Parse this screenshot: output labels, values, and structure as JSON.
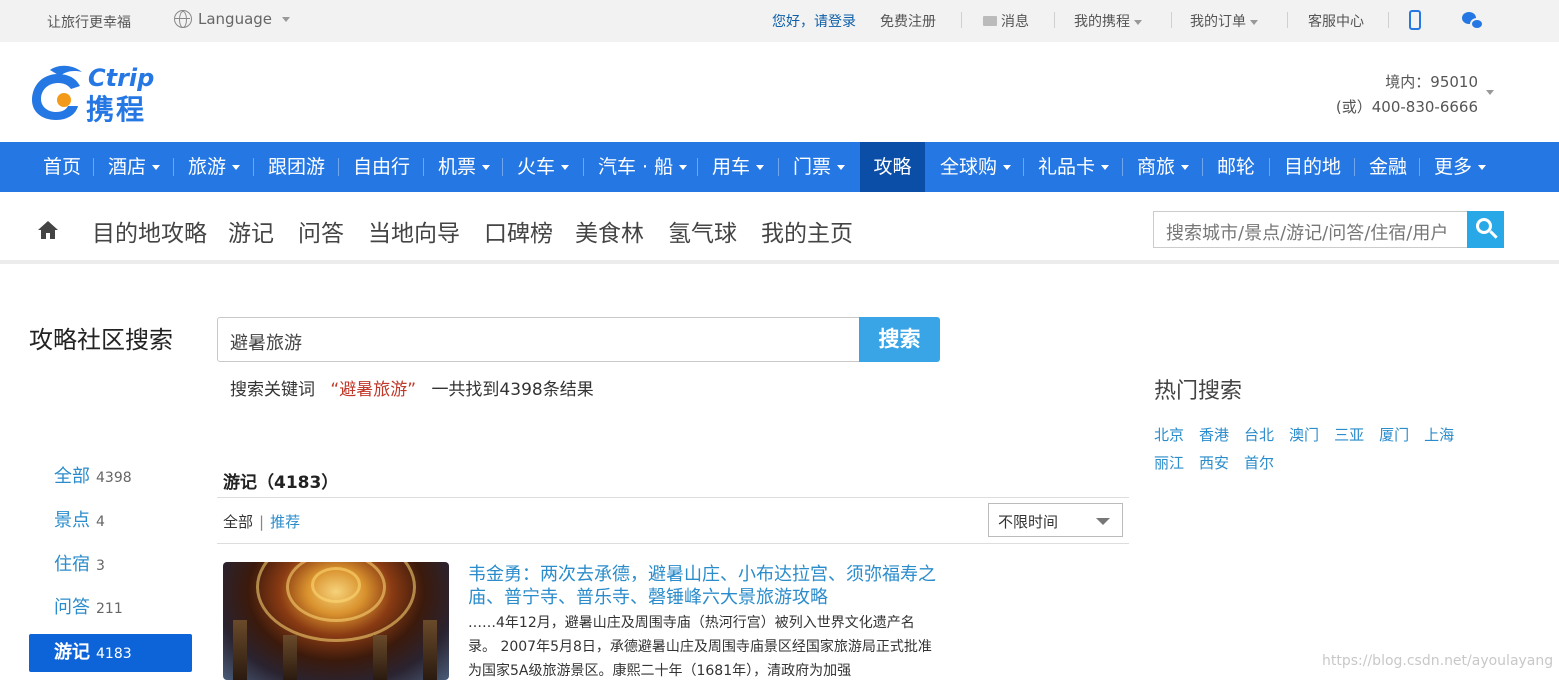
{
  "topbar": {
    "slogan": "让旅行更幸福",
    "language": "Language",
    "greeting": "您好，请登录",
    "register": "免费注册",
    "messages": "消息",
    "my_ctrip": "我的携程",
    "my_orders": "我的订单",
    "service": "客服中心"
  },
  "header": {
    "logo_en": "Ctrip",
    "logo_cn": "携程",
    "hotline_domestic": "境内：95010",
    "hotline_alt": "(或）400-830-6666"
  },
  "mainnav": [
    {
      "label": "首页",
      "caret": false
    },
    {
      "label": "酒店",
      "caret": true
    },
    {
      "label": "旅游",
      "caret": true
    },
    {
      "label": "跟团游",
      "caret": false
    },
    {
      "label": "自由行",
      "caret": false
    },
    {
      "label": "机票",
      "caret": true
    },
    {
      "label": "火车",
      "caret": true
    },
    {
      "label": "汽车 · 船",
      "caret": true
    },
    {
      "label": "用车",
      "caret": true
    },
    {
      "label": "门票",
      "caret": true
    },
    {
      "label": "攻略",
      "caret": false,
      "active": true
    },
    {
      "label": "全球购",
      "caret": true
    },
    {
      "label": "礼品卡",
      "caret": true
    },
    {
      "label": "商旅",
      "caret": true
    },
    {
      "label": "邮轮",
      "caret": false
    },
    {
      "label": "目的地",
      "caret": false
    },
    {
      "label": "金融",
      "caret": false
    },
    {
      "label": "更多",
      "caret": true
    }
  ],
  "subnav": {
    "links": [
      "目的地攻略",
      "游记",
      "问答",
      "当地向导",
      "口碑榜",
      "美食林",
      "氢气球",
      "我的主页"
    ],
    "search_placeholder": "搜索城市/景点/游记/问答/住宿/用户"
  },
  "search": {
    "page_title": "攻略社区搜索",
    "query": "避暑旅游",
    "button": "搜索",
    "result_prefix": "搜索关键词",
    "result_keyword": "“避暑旅游”",
    "result_suffix": "一共找到4398条结果"
  },
  "filters": [
    {
      "label": "全部",
      "count": "4398"
    },
    {
      "label": "景点",
      "count": "4"
    },
    {
      "label": "住宿",
      "count": "3"
    },
    {
      "label": "问答",
      "count": "211"
    },
    {
      "label": "游记",
      "count": "4183",
      "active": true
    }
  ],
  "results": {
    "section_title": "游记（4183）",
    "tab_all": "全部",
    "tab_sep": "|",
    "tab_recommended": "推荐",
    "time_filter": "不限时间",
    "items": [
      {
        "title": "韦金勇：两次去承德，避暑山庄、小布达拉宫、须弥福寿之庙、普宁寺、普乐寺、磬锤峰六大景旅游攻略",
        "snippet": "……4年12月，避暑山庄及周围寺庙（热河行宫）被列入世界文化遗产名录。 2007年5月8日，承德避暑山庄及周围寺庙景区经国家旅游局正式批准为国家5A级旅游景区。康熙二十年（1681年），清政府为加强"
      }
    ]
  },
  "hot": {
    "title": "热门搜索",
    "tags": [
      "北京",
      "香港",
      "台北",
      "澳门",
      "三亚",
      "厦门",
      "上海",
      "丽江",
      "西安",
      "首尔"
    ]
  },
  "watermark": "https://blog.csdn.net/ayoulayang"
}
